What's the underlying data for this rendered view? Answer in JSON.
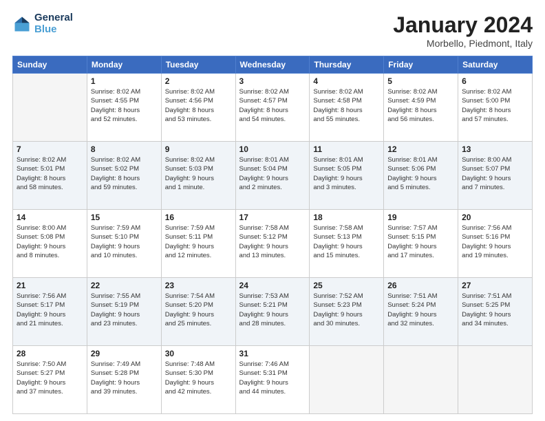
{
  "header": {
    "logo_line1": "General",
    "logo_line2": "Blue",
    "month": "January 2024",
    "location": "Morbello, Piedmont, Italy"
  },
  "days_of_week": [
    "Sunday",
    "Monday",
    "Tuesday",
    "Wednesday",
    "Thursday",
    "Friday",
    "Saturday"
  ],
  "weeks": [
    [
      {
        "day": "",
        "info": ""
      },
      {
        "day": "1",
        "info": "Sunrise: 8:02 AM\nSunset: 4:55 PM\nDaylight: 8 hours\nand 52 minutes."
      },
      {
        "day": "2",
        "info": "Sunrise: 8:02 AM\nSunset: 4:56 PM\nDaylight: 8 hours\nand 53 minutes."
      },
      {
        "day": "3",
        "info": "Sunrise: 8:02 AM\nSunset: 4:57 PM\nDaylight: 8 hours\nand 54 minutes."
      },
      {
        "day": "4",
        "info": "Sunrise: 8:02 AM\nSunset: 4:58 PM\nDaylight: 8 hours\nand 55 minutes."
      },
      {
        "day": "5",
        "info": "Sunrise: 8:02 AM\nSunset: 4:59 PM\nDaylight: 8 hours\nand 56 minutes."
      },
      {
        "day": "6",
        "info": "Sunrise: 8:02 AM\nSunset: 5:00 PM\nDaylight: 8 hours\nand 57 minutes."
      }
    ],
    [
      {
        "day": "7",
        "info": "Sunrise: 8:02 AM\nSunset: 5:01 PM\nDaylight: 8 hours\nand 58 minutes."
      },
      {
        "day": "8",
        "info": "Sunrise: 8:02 AM\nSunset: 5:02 PM\nDaylight: 8 hours\nand 59 minutes."
      },
      {
        "day": "9",
        "info": "Sunrise: 8:02 AM\nSunset: 5:03 PM\nDaylight: 9 hours\nand 1 minute."
      },
      {
        "day": "10",
        "info": "Sunrise: 8:01 AM\nSunset: 5:04 PM\nDaylight: 9 hours\nand 2 minutes."
      },
      {
        "day": "11",
        "info": "Sunrise: 8:01 AM\nSunset: 5:05 PM\nDaylight: 9 hours\nand 3 minutes."
      },
      {
        "day": "12",
        "info": "Sunrise: 8:01 AM\nSunset: 5:06 PM\nDaylight: 9 hours\nand 5 minutes."
      },
      {
        "day": "13",
        "info": "Sunrise: 8:00 AM\nSunset: 5:07 PM\nDaylight: 9 hours\nand 7 minutes."
      }
    ],
    [
      {
        "day": "14",
        "info": "Sunrise: 8:00 AM\nSunset: 5:08 PM\nDaylight: 9 hours\nand 8 minutes."
      },
      {
        "day": "15",
        "info": "Sunrise: 7:59 AM\nSunset: 5:10 PM\nDaylight: 9 hours\nand 10 minutes."
      },
      {
        "day": "16",
        "info": "Sunrise: 7:59 AM\nSunset: 5:11 PM\nDaylight: 9 hours\nand 12 minutes."
      },
      {
        "day": "17",
        "info": "Sunrise: 7:58 AM\nSunset: 5:12 PM\nDaylight: 9 hours\nand 13 minutes."
      },
      {
        "day": "18",
        "info": "Sunrise: 7:58 AM\nSunset: 5:13 PM\nDaylight: 9 hours\nand 15 minutes."
      },
      {
        "day": "19",
        "info": "Sunrise: 7:57 AM\nSunset: 5:15 PM\nDaylight: 9 hours\nand 17 minutes."
      },
      {
        "day": "20",
        "info": "Sunrise: 7:56 AM\nSunset: 5:16 PM\nDaylight: 9 hours\nand 19 minutes."
      }
    ],
    [
      {
        "day": "21",
        "info": "Sunrise: 7:56 AM\nSunset: 5:17 PM\nDaylight: 9 hours\nand 21 minutes."
      },
      {
        "day": "22",
        "info": "Sunrise: 7:55 AM\nSunset: 5:19 PM\nDaylight: 9 hours\nand 23 minutes."
      },
      {
        "day": "23",
        "info": "Sunrise: 7:54 AM\nSunset: 5:20 PM\nDaylight: 9 hours\nand 25 minutes."
      },
      {
        "day": "24",
        "info": "Sunrise: 7:53 AM\nSunset: 5:21 PM\nDaylight: 9 hours\nand 28 minutes."
      },
      {
        "day": "25",
        "info": "Sunrise: 7:52 AM\nSunset: 5:23 PM\nDaylight: 9 hours\nand 30 minutes."
      },
      {
        "day": "26",
        "info": "Sunrise: 7:51 AM\nSunset: 5:24 PM\nDaylight: 9 hours\nand 32 minutes."
      },
      {
        "day": "27",
        "info": "Sunrise: 7:51 AM\nSunset: 5:25 PM\nDaylight: 9 hours\nand 34 minutes."
      }
    ],
    [
      {
        "day": "28",
        "info": "Sunrise: 7:50 AM\nSunset: 5:27 PM\nDaylight: 9 hours\nand 37 minutes."
      },
      {
        "day": "29",
        "info": "Sunrise: 7:49 AM\nSunset: 5:28 PM\nDaylight: 9 hours\nand 39 minutes."
      },
      {
        "day": "30",
        "info": "Sunrise: 7:48 AM\nSunset: 5:30 PM\nDaylight: 9 hours\nand 42 minutes."
      },
      {
        "day": "31",
        "info": "Sunrise: 7:46 AM\nSunset: 5:31 PM\nDaylight: 9 hours\nand 44 minutes."
      },
      {
        "day": "",
        "info": ""
      },
      {
        "day": "",
        "info": ""
      },
      {
        "day": "",
        "info": ""
      }
    ]
  ]
}
